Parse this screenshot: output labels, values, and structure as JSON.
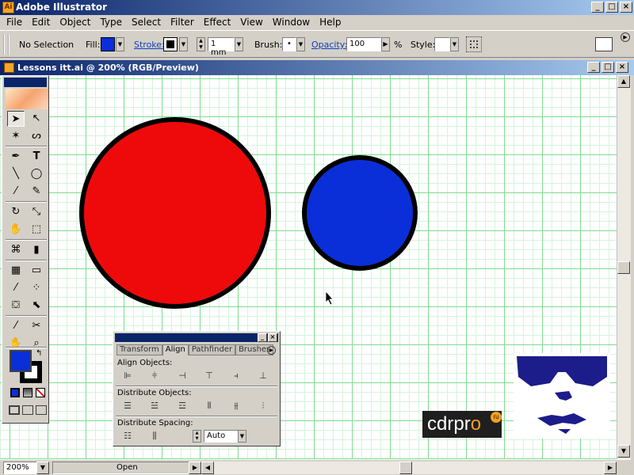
{
  "window": {
    "title": "Adobe Illustrator",
    "app_icon": "Ai"
  },
  "menu": [
    "File",
    "Edit",
    "Object",
    "Type",
    "Select",
    "Filter",
    "Effect",
    "View",
    "Window",
    "Help"
  ],
  "control_bar": {
    "selection": "No Selection",
    "fill_label": "Fill:",
    "fill_color": "#0a2fd9",
    "stroke_label": "Stroke:",
    "stroke_color": "#000000",
    "stroke_weight": "1 mm",
    "brush_label": "Brush:",
    "brush_value": "•",
    "opacity_label": "Opacity:",
    "opacity_value": "100",
    "opacity_unit": "%",
    "style_label": "Style:"
  },
  "document": {
    "title": "Lessons itt.ai @ 200% (RGB/Preview)",
    "shapes": [
      {
        "name": "red-circle",
        "fill": "#ee0a0a",
        "stroke": "#000000"
      },
      {
        "name": "blue-circle",
        "fill": "#0a2fd9",
        "stroke": "#000000"
      }
    ]
  },
  "align_panel": {
    "tabs": [
      "Transform",
      "Align",
      "Pathfinder",
      "Brushes"
    ],
    "active_tab": "Align",
    "align_objects_label": "Align Objects:",
    "distribute_objects_label": "Distribute Objects:",
    "distribute_spacing_label": "Distribute Spacing:",
    "spacing_value": "Auto"
  },
  "status_bar": {
    "zoom": "200%",
    "mode": "Open"
  },
  "watermark": {
    "text_a": "cdrpr",
    "text_b": "o",
    "badge": "ru"
  }
}
